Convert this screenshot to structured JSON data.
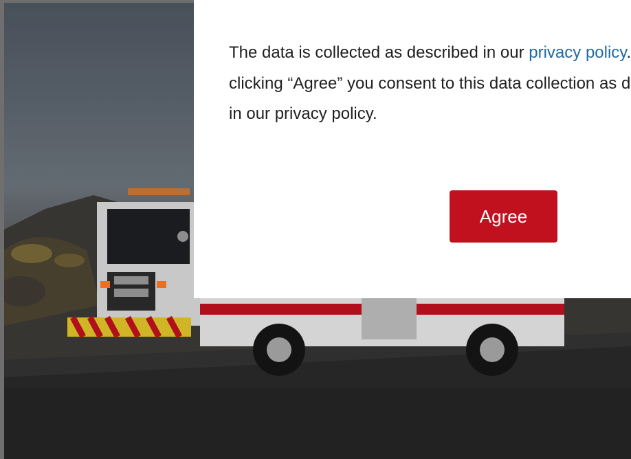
{
  "consent": {
    "text_before_link": "The data is collected as described in our ",
    "link_text": "privacy policy",
    "text_after_link": ". By clicking “Agree” you consent to this data collection as described in our privacy policy.",
    "agree_label": "Agree"
  },
  "background": {
    "image": "fire-truck-photo"
  },
  "colors": {
    "accent": "#c1111f",
    "link": "#1f6aa5",
    "text": "#1f1f1f"
  }
}
